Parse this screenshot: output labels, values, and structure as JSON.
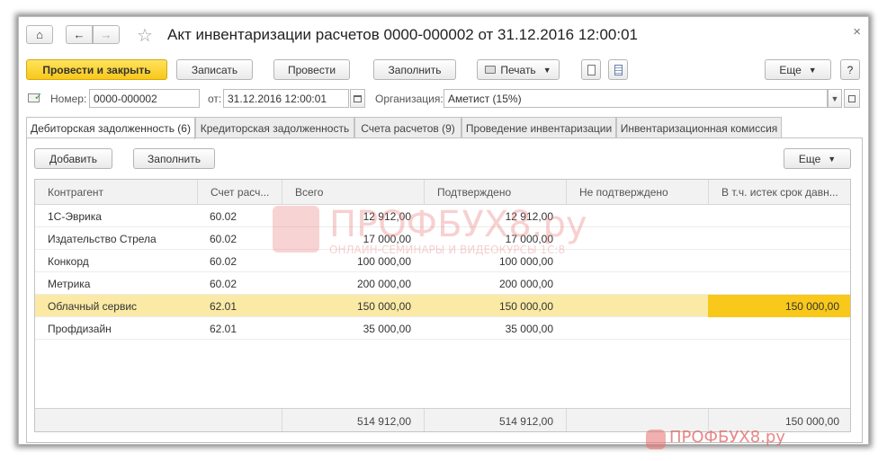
{
  "window": {
    "title": "Акт инвентаризации расчетов 0000-000002 от 31.12.2016 12:00:01",
    "nav": {
      "home": "⌂",
      "back": "←",
      "forward": "→",
      "star": "☆",
      "close": "×"
    }
  },
  "toolbar": {
    "post_close": "Провести и закрыть",
    "save": "Записать",
    "post": "Провести",
    "fill": "Заполнить",
    "print": "Печать",
    "more": "Еще",
    "help": "?"
  },
  "fields": {
    "number_label": "Номер:",
    "number_value": "0000-000002",
    "date_label": "от:",
    "date_value": "31.12.2016 12:00:01",
    "org_label": "Организация:",
    "org_value": "Аметист (15%)"
  },
  "tabs": [
    "Дебиторская задолженность (6)",
    "Кредиторская задолженность",
    "Счета расчетов (9)",
    "Проведение инвентаризации",
    "Инвентаризационная комиссия"
  ],
  "subtoolbar": {
    "add": "Добавить",
    "fill": "Заполнить",
    "more": "Еще"
  },
  "table": {
    "columns": [
      "Контрагент",
      "Счет расч...",
      "Всего",
      "Подтверждено",
      "Не подтверждено",
      "В т.ч. истек срок давн..."
    ],
    "rows": [
      [
        "1С-Эврика",
        "60.02",
        "12 912,00",
        "12 912,00",
        "",
        ""
      ],
      [
        "Издательство Стрела",
        "60.02",
        "17 000,00",
        "17 000,00",
        "",
        ""
      ],
      [
        "Конкорд",
        "60.02",
        "100 000,00",
        "100 000,00",
        "",
        ""
      ],
      [
        "Метрика",
        "60.02",
        "200 000,00",
        "200 000,00",
        "",
        ""
      ],
      [
        "Облачный сервис",
        "62.01",
        "150 000,00",
        "150 000,00",
        "",
        "150 000,00"
      ],
      [
        "Профдизайн",
        "62.01",
        "35 000,00",
        "35 000,00",
        "",
        ""
      ]
    ],
    "selected_row": 4,
    "totals": [
      "",
      "",
      "514 912,00",
      "514 912,00",
      "",
      "150 000,00"
    ]
  },
  "watermark": {
    "brand": "ПРОФБУХ8.ру",
    "tagline": "ОНЛАЙН-СЕМИНАРЫ И ВИДЕОКУРСЫ 1С:8",
    "footer_brand": "ПРОФБУХ8.ру"
  },
  "colors": {
    "primary_button": "#f8c81a",
    "selected_row": "#fbeaa6",
    "highlight_cell": "#f8c81a"
  }
}
